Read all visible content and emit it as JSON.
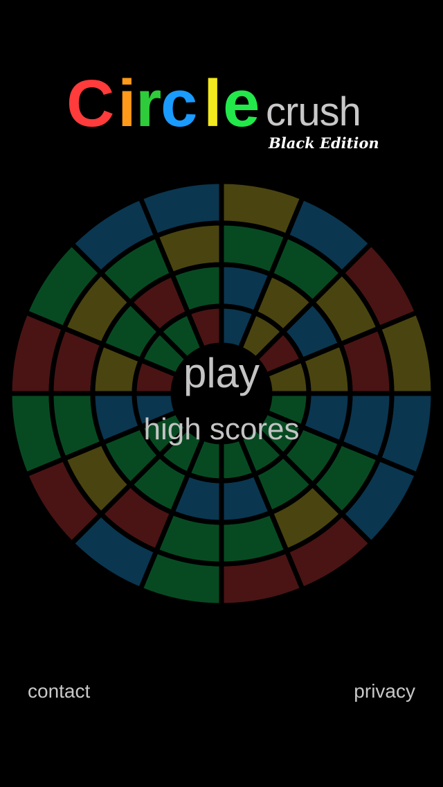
{
  "logo": {
    "letters": [
      {
        "char": "C",
        "color": "#ff3b3b"
      },
      {
        "char": "i",
        "color": "#ff9a1a"
      },
      {
        "char": "r",
        "color": "#2ecc3a"
      },
      {
        "char": "c",
        "color": "#1a9bff"
      },
      {
        "char": "l",
        "color": "#f2e81e"
      },
      {
        "char": "e",
        "color": "#22e84a"
      }
    ],
    "suffix": "crush",
    "edition": "Black Edition"
  },
  "wheel": {
    "palette": {
      "R": "#4a1414",
      "G": "#074a22",
      "B": "#0a3650",
      "Y": "#4a4410"
    },
    "ring_colors_outer_to_inner": [
      [
        "Y",
        "B",
        "R",
        "Y",
        "B",
        "B",
        "R",
        "R",
        "G",
        "B",
        "R",
        "G",
        "R",
        "G",
        "B",
        "B"
      ],
      [
        "G",
        "G",
        "Y",
        "R",
        "B",
        "G",
        "Y",
        "G",
        "G",
        "R",
        "Y",
        "G",
        "R",
        "Y",
        "G",
        "Y"
      ],
      [
        "B",
        "Y",
        "B",
        "Y",
        "B",
        "G",
        "G",
        "B",
        "B",
        "G",
        "G",
        "B",
        "Y",
        "G",
        "R",
        "G"
      ],
      [
        "B",
        "Y",
        "R",
        "Y",
        "G",
        "G",
        "G",
        "G",
        "G",
        "G",
        "G",
        "B",
        "R",
        "G",
        "G",
        "R"
      ]
    ]
  },
  "menu": {
    "play_label": "play",
    "high_scores_label": "high scores"
  },
  "footer": {
    "contact_label": "contact",
    "privacy_label": "privacy"
  }
}
